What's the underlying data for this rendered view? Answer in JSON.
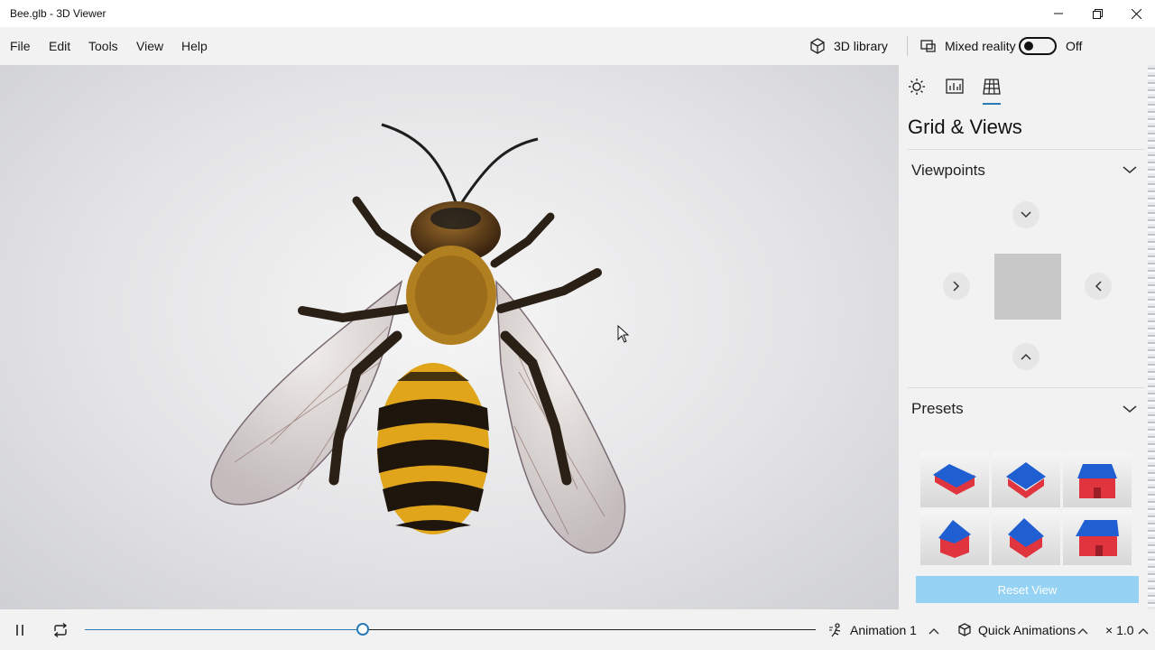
{
  "window": {
    "title": "Bee.glb - 3D Viewer"
  },
  "menu": {
    "file": "File",
    "edit": "Edit",
    "tools": "Tools",
    "view": "View",
    "help": "Help"
  },
  "header": {
    "library_label": "3D library",
    "mixed_reality_label": "Mixed reality",
    "mixed_reality_state": "Off"
  },
  "panel": {
    "tabs": [
      {
        "icon": "sun-icon"
      },
      {
        "icon": "stats-icon"
      },
      {
        "icon": "grid-icon"
      }
    ],
    "title": "Grid & Views",
    "viewpoints_label": "Viewpoints",
    "presets_label": "Presets",
    "reset_label": "Reset View"
  },
  "bottom": {
    "animation_progress": 0.38,
    "animation_label": "Animation 1",
    "quick_animations_label": "Quick Animations",
    "speed_label": "× 1.0"
  },
  "colors": {
    "accent": "#2a7ab8",
    "reset_button": "#95d2f3",
    "house_red": "#e0343f",
    "house_roof": "#1f5fd1"
  }
}
